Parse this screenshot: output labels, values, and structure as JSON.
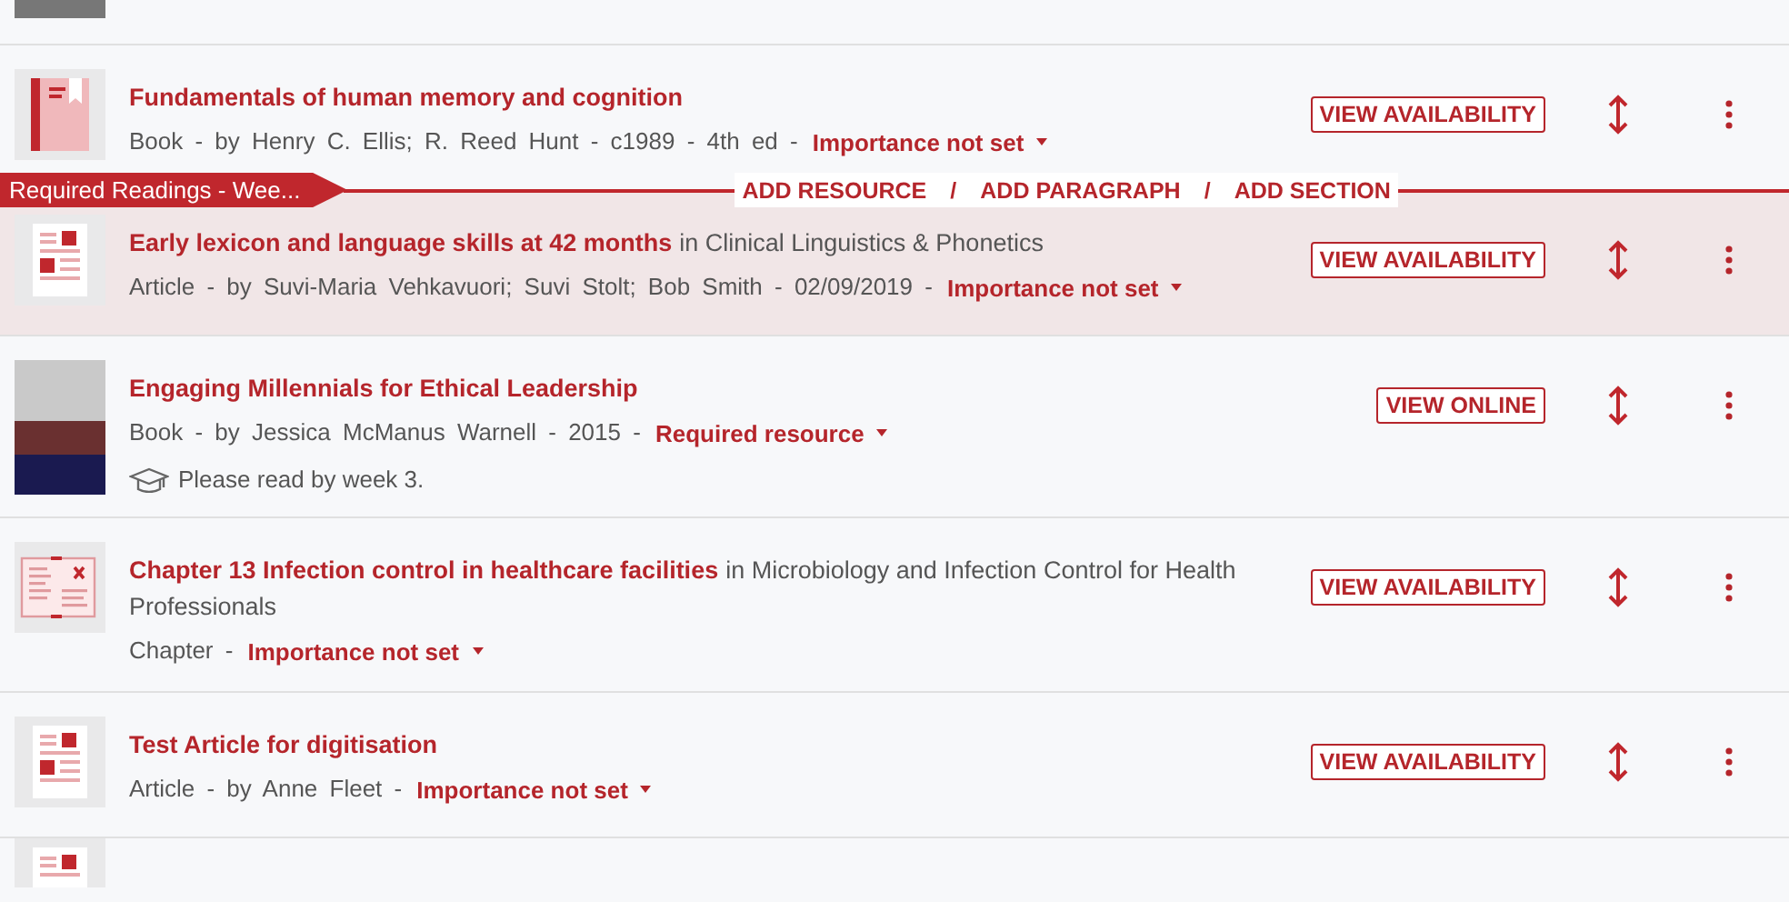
{
  "section": {
    "label": "Required Readings - Wee...",
    "actions": [
      "ADD RESOURCE",
      "ADD PARAGRAPH",
      "ADD SECTION"
    ],
    "separator": "/"
  },
  "items": [
    {
      "kind": "book",
      "title": "Fundamentals of human memory and cognition",
      "meta": "Book - by Henry C. Ellis; R. Reed Hunt - c1989 - 4th ed -",
      "importance": "Importance not set",
      "action": "VIEW AVAILABILITY",
      "highlighted": false
    },
    {
      "kind": "article",
      "title": "Early lexicon and language skills at 42 months",
      "source": "in Clinical Linguistics & Phonetics",
      "meta": "Article - by Suvi-Maria Vehkavuori; Suvi Stolt; Bob Smith - 02/09/2019 -",
      "importance": "Importance not set",
      "action": "VIEW AVAILABILITY",
      "highlighted": true
    },
    {
      "kind": "cover",
      "title": "Engaging Millennials for Ethical Leadership",
      "meta": "Book - by Jessica McManus Warnell - 2015 -",
      "importance": "Required resource",
      "note": "Please read by week 3.",
      "action": "VIEW ONLINE",
      "highlighted": false
    },
    {
      "kind": "chapter",
      "title": "Chapter 13 Infection control in healthcare facilities",
      "source": "in Microbiology and Infection Control for Health Professionals",
      "meta": "Chapter -",
      "importance": "Importance not set",
      "action": "VIEW AVAILABILITY",
      "highlighted": false
    },
    {
      "kind": "article",
      "title": "Test Article for digitisation",
      "meta": "Article - by Anne Fleet -",
      "importance": "Importance not set",
      "action": "VIEW AVAILABILITY",
      "highlighted": false
    }
  ]
}
